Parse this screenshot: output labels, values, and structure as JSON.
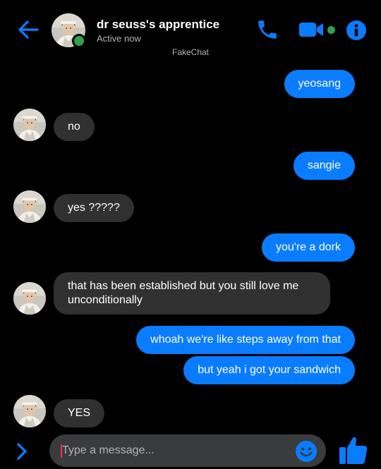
{
  "header": {
    "contact_name": "dr seuss's apprentice",
    "status": "Active now",
    "watermark": "FakeChat"
  },
  "icons": {
    "back": "back-arrow-icon",
    "call": "phone-icon",
    "video": "video-camera-icon",
    "info": "info-icon",
    "expand": "chevron-right-icon",
    "emoji": "emoji-smile-icon",
    "like": "thumbs-up-icon"
  },
  "colors": {
    "accent": "#0a7cff",
    "received_bubble": "#303030",
    "online": "#31a24c",
    "background": "#000000"
  },
  "messages": [
    {
      "direction": "sent",
      "text": "yeosang"
    },
    {
      "direction": "received",
      "text": "no"
    },
    {
      "direction": "sent",
      "text": "sangie"
    },
    {
      "direction": "received",
      "text": "yes ?????"
    },
    {
      "direction": "sent",
      "text": "you're a dork"
    },
    {
      "direction": "received",
      "text": "that has been established but you still love me unconditionally"
    },
    {
      "direction": "sent",
      "text": "whoah we're like steps away from that"
    },
    {
      "direction": "sent",
      "text": "but yeah i got your sandwich"
    },
    {
      "direction": "received",
      "text": "YES"
    }
  ],
  "composer": {
    "placeholder": "Type a message..."
  }
}
